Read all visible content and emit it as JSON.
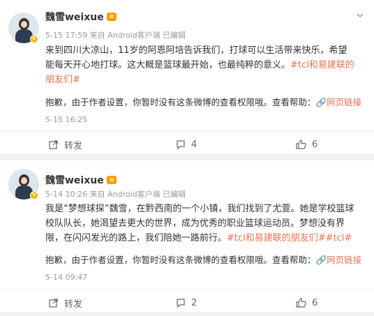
{
  "posts": [
    {
      "author": "魏雪weixue",
      "meta": "5-15 17:59 来自 Android客户端 已编辑",
      "text": "来到四川大凉山，11岁的阿恩阿培告诉我们，打球可以生活带来快乐，希望能每天开心地打球。这大概是篮球最开始，也最纯粹的意义。",
      "tags": [
        "#tcl和易建联的朋友们#"
      ],
      "notice": "抱歉，由于作者设置，你暂时没有这条微博的查看权限哦。查看帮助：",
      "notice_link": "网页链接",
      "notice_time": "5-15 16:25",
      "repost_label": "转发",
      "comments": "4",
      "likes": "6"
    },
    {
      "author": "魏雪weixue",
      "meta": "5-14 10:26 来自 Android客户端 已编辑",
      "text": "我是“梦想球探”魏雪，在黔西南的一个小镇，我们找到了尤萱。她是学校篮球校队队长，她渴望去更大的世界，成为优秀的职业篮球运动员。梦想没有界限，在闪闪发光的路上，我们陪她一路前行。",
      "tags": [
        "#tcl和易建联的朋友们#",
        "#tcl#"
      ],
      "notice": "抱歉，由于作者设置，你暂时没有这条微博的查看权限哦。查看帮助：",
      "notice_link": "网页链接",
      "notice_time": "5-14 09:47",
      "repost_label": "转发",
      "comments": "2",
      "likes": "6"
    }
  ]
}
